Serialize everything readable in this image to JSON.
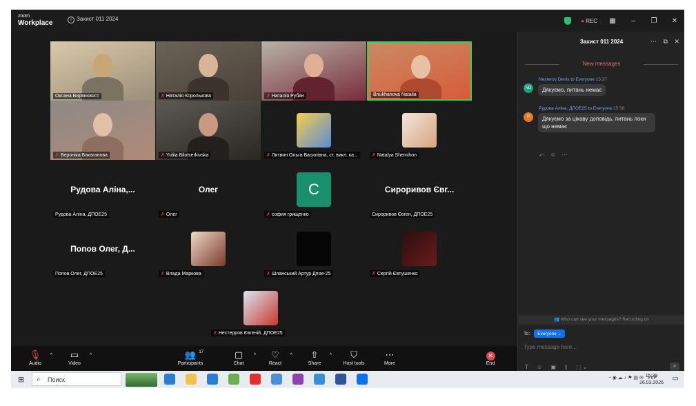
{
  "titlebar": {
    "logo_small": "zoom",
    "logo_big": "Workplace",
    "meeting_title": "Захист 011 2024",
    "rec_label": "REC"
  },
  "participants": [
    {
      "name": "Оксана Вирвихвост",
      "muted": false,
      "kind": "photo",
      "colors": [
        "#d9c9a8",
        "#c9a774",
        "#9b8e7a"
      ]
    },
    {
      "name": "Наталія Королькова",
      "muted": true,
      "kind": "photo",
      "colors": [
        "#6b6258",
        "#d8b598",
        "#4a4037"
      ]
    },
    {
      "name": "Наталія Рубан",
      "muted": true,
      "kind": "photo",
      "colors": [
        "#b7b3a7",
        "#e0b095",
        "#7a2b3a"
      ]
    },
    {
      "name": "Briukhanova Natalia",
      "muted": false,
      "kind": "photo",
      "active": true,
      "colors": [
        "#c98b63",
        "#e8c1a4",
        "#d95a3a"
      ]
    },
    {
      "name": "Вероніка Бакаганова",
      "muted": true,
      "kind": "photo",
      "colors": [
        "#8d8a86",
        "#e2c0a7",
        "#b08a78"
      ]
    },
    {
      "name": "Yuliia Bilotserkivska",
      "muted": true,
      "kind": "photo",
      "colors": [
        "#5c5a52",
        "#c99a80",
        "#2a2724"
      ]
    },
    {
      "name": "Литвин Ольга Василівна, ст. викл. ка...",
      "muted": true,
      "kind": "avatar",
      "colors": [
        "#f4cf4e",
        "#5b8bd6"
      ]
    },
    {
      "name": "Natalya Shemihon",
      "muted": true,
      "kind": "avatar",
      "colors": [
        "#f1e6dc",
        "#d9a37f"
      ]
    },
    {
      "name": "Рудова Аліна, ДПОЕ25",
      "muted": false,
      "kind": "text",
      "display": "Рудова Аліна,..."
    },
    {
      "name": "Олег",
      "muted": true,
      "kind": "text",
      "display": "Олег"
    },
    {
      "name": "софия грищенко",
      "muted": true,
      "kind": "letter",
      "letter": "C",
      "colors": [
        "#1a8f6b"
      ]
    },
    {
      "name": "Сироривов Євген, ДПОЕ25",
      "muted": false,
      "kind": "text",
      "display": "Сироривов Євг..."
    },
    {
      "name": "Попов Олег, ДПОЕ25",
      "muted": false,
      "kind": "text",
      "display": "Попов Олег, Д..."
    },
    {
      "name": "Влада Маркова",
      "muted": true,
      "kind": "avatar",
      "colors": [
        "#f0d8c8",
        "#7a3a2a"
      ]
    },
    {
      "name": "Шланський Артур Дпое-25",
      "muted": true,
      "kind": "avatar",
      "colors": [
        "#050505",
        "#050505"
      ]
    },
    {
      "name": "Сергій Євтушенко",
      "muted": true,
      "kind": "avatar",
      "colors": [
        "#2a0f0f",
        "#6b1a1a"
      ]
    },
    {
      "name": "Нестерров Євгеній, ДПОЕ25",
      "muted": true,
      "kind": "avatar",
      "colors": [
        "#d9e6f2",
        "#c8372d"
      ]
    }
  ],
  "toolbar": {
    "audio": "Audio",
    "video": "Video",
    "participants": "Participants",
    "participants_count": "17",
    "chat": "Chat",
    "react": "React",
    "share": "Share",
    "host_tools": "Host tools",
    "more": "More",
    "end": "End"
  },
  "chat": {
    "title": "Захист 011 2024",
    "new_messages": "New messages",
    "messages": [
      {
        "initials": "ND",
        "sender": "Nesterov Denis",
        "to": "to",
        "recipient": "Everyone",
        "time": "15:37",
        "text": "Дякуємо, питань немає",
        "avatar_color": "#1aa27a"
      },
      {
        "initials": "P",
        "sender": "Рудова Аліна, ДПОЕ25",
        "to": "to",
        "recipient": "Everyone",
        "time": "15:38",
        "text": "Дякуємо за цікаву доповідь, питань поки що немає",
        "avatar_color": "#e57a2a"
      }
    ],
    "who_can_see": "Who can see your messages? Recording on",
    "to_label": "To:",
    "to_value": "Everyone",
    "placeholder": "Type message here..."
  },
  "taskbar": {
    "search_placeholder": "Поиск",
    "lang": "УКР",
    "time": "15:39",
    "date": "26.03.2026",
    "app_colors": [
      "#2b7cd3",
      "#f2c14e",
      "#2b7cd3",
      "#6ab04c",
      "#e03131",
      "#4a90d9",
      "#8e44ad",
      "#3b8fd8",
      "#2b579a",
      "#0e72ed"
    ]
  }
}
